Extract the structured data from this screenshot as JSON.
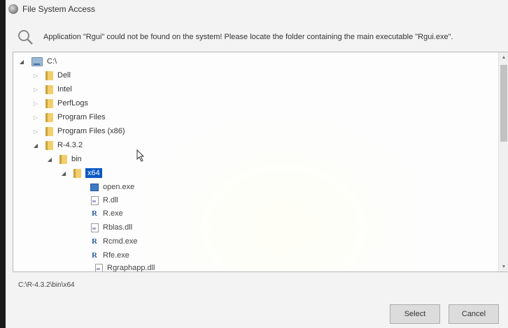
{
  "window": {
    "title": "File System Access"
  },
  "message": "Application \"Rgui\" could not be found on the system! Please locate the folder containing the main executable \"Rgui.exe\".",
  "tree": {
    "root": {
      "label": "C:\\",
      "expanded": true
    },
    "folders": [
      {
        "label": "Dell",
        "expanded": false
      },
      {
        "label": "Intel",
        "expanded": false
      },
      {
        "label": "PerfLogs",
        "expanded": false
      },
      {
        "label": "Program Files",
        "expanded": false
      },
      {
        "label": "Program Files (x86)",
        "expanded": false
      },
      {
        "label": "R-4.3.2",
        "expanded": true
      }
    ],
    "subfolder": {
      "label": "bin",
      "expanded": true
    },
    "selected": {
      "label": "x64",
      "expanded": true
    },
    "files": [
      {
        "label": "open.exe",
        "icon": "exe-icon"
      },
      {
        "label": "R.dll",
        "icon": "dll-icon"
      },
      {
        "label": "R.exe",
        "icon": "r-icon"
      },
      {
        "label": "Rblas.dll",
        "icon": "dll-icon"
      },
      {
        "label": "Rcmd.exe",
        "icon": "r-icon"
      },
      {
        "label": "Rfe.exe",
        "icon": "r-icon"
      },
      {
        "label": "Rgraphapp.dll",
        "icon": "dll-icon"
      }
    ]
  },
  "path": "C:\\R-4.3.2\\bin\\x64",
  "buttons": {
    "select": "Select",
    "cancel": "Cancel"
  },
  "colors": {
    "selection": "#0a58c4",
    "folder": "#f2cf6c",
    "r_icon": "#2e5f9e"
  }
}
